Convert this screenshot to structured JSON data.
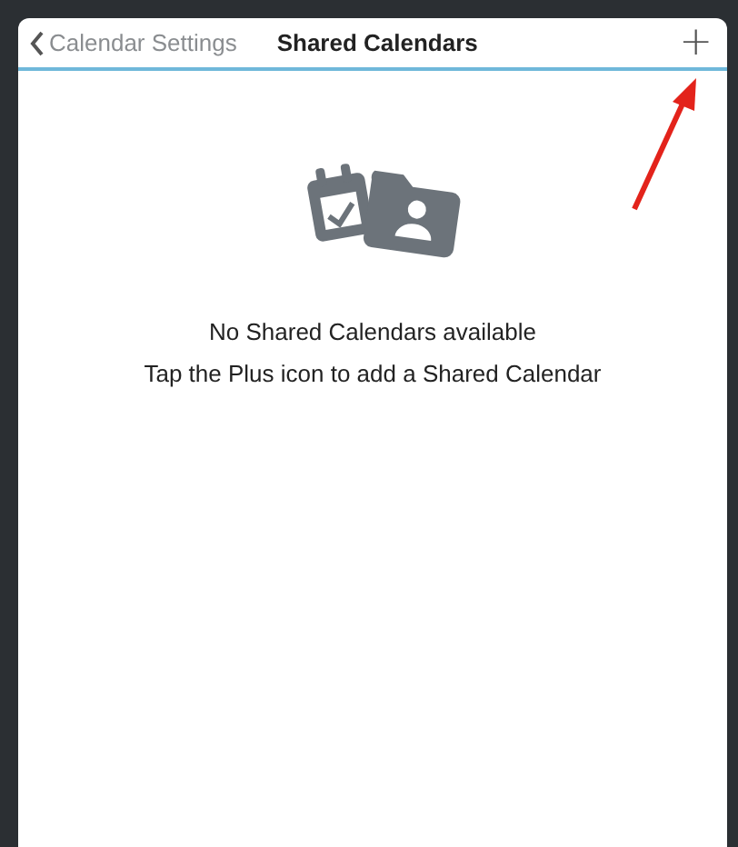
{
  "header": {
    "back_label": "Calendar Settings",
    "title": "Shared Calendars",
    "add_symbol": "+"
  },
  "empty_state": {
    "message": "No Shared Calendars available",
    "hint": "Tap the Plus icon to add a Shared Calendar"
  },
  "annotation": {
    "kind": "arrow"
  }
}
